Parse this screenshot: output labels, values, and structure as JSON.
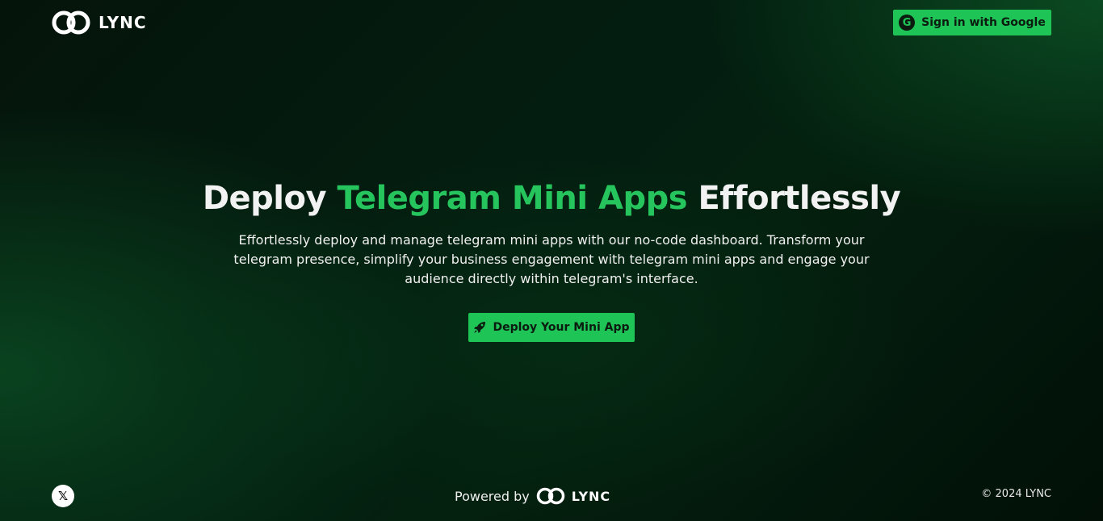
{
  "header": {
    "brand": "LYNC",
    "signin_label": "Sign in with Google",
    "signin_icon": "google-icon"
  },
  "hero": {
    "title_part1": "Deploy ",
    "title_accent": "Telegram Mini Apps",
    "title_part2": " Effortlessly",
    "subtitle": "Effortlessly deploy and manage telegram mini apps with our no-code dashboard. Transform your telegram presence, simplify your business engagement with telegram mini apps and engage your audience directly within telegram's interface.",
    "cta_label": "Deploy Your Mini App",
    "cta_icon": "rocket-icon"
  },
  "footer": {
    "social_icon": "x-twitter-icon",
    "powered_by": "Powered by",
    "powered_brand": "LYNC",
    "copyright": "© 2024 LYNC"
  },
  "colors": {
    "accent": "#1fc457",
    "accent_text": "#26c45d",
    "background": "#031e10"
  }
}
